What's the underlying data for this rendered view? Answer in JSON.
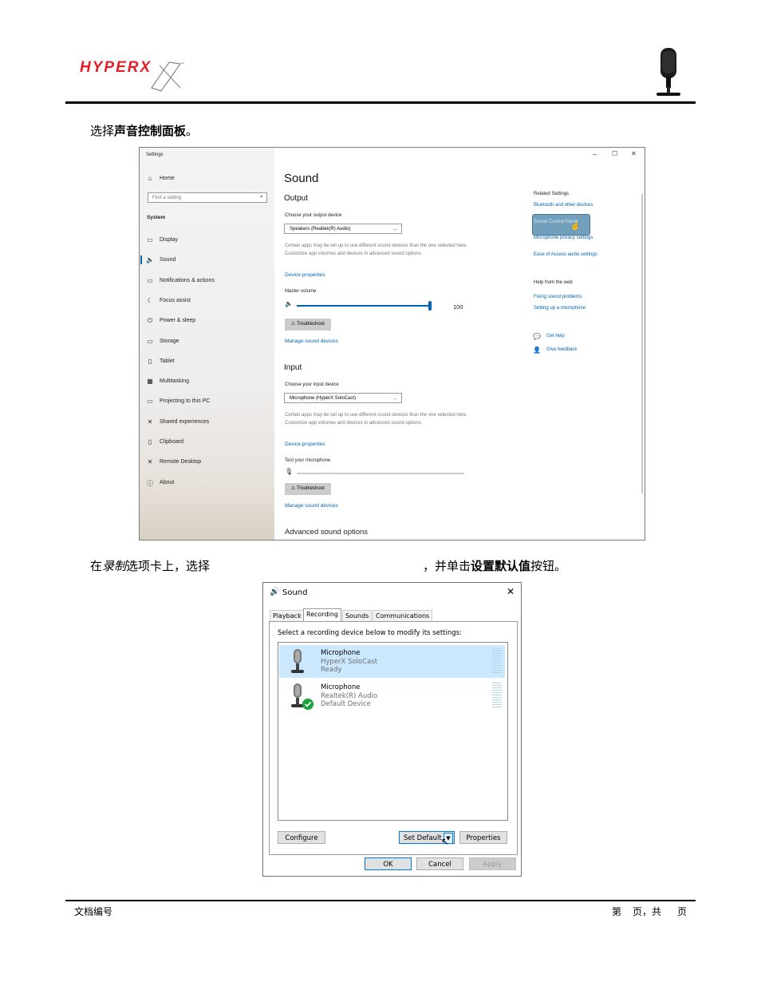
{
  "header": {
    "logo_text": "HYPERX",
    "logo_tm": "™"
  },
  "instructions": {
    "step1_prefix": "选择",
    "step1_bold": "声音控制面板",
    "step1_suffix": "。",
    "step2_prefix": "在",
    "step2_italic": "录制",
    "step2_mid": "选项卡上，选择",
    "step2_mid2": "，并单击",
    "step2_bold": "设置默认值",
    "step2_suffix": "按钮。"
  },
  "settings": {
    "window_title": "Settings",
    "controls": {
      "minimize": "–",
      "maximize": "☐",
      "close": "✕"
    },
    "home": "Home",
    "search_placeholder": "Find a setting",
    "section": "System",
    "nav": [
      {
        "label": "Display",
        "icon": "display-icon",
        "glyph": "▭"
      },
      {
        "label": "Sound",
        "icon": "speaker-icon",
        "glyph": "🔈"
      },
      {
        "label": "Notifications & actions",
        "icon": "notification-icon",
        "glyph": "▭"
      },
      {
        "label": "Focus assist",
        "icon": "moon-icon",
        "glyph": "☾"
      },
      {
        "label": "Power & sleep",
        "icon": "power-icon",
        "glyph": "⏻"
      },
      {
        "label": "Storage",
        "icon": "storage-icon",
        "glyph": "▭"
      },
      {
        "label": "Tablet",
        "icon": "tablet-icon",
        "glyph": "▯"
      },
      {
        "label": "Multitasking",
        "icon": "multitasking-icon",
        "glyph": "▦"
      },
      {
        "label": "Projecting to this PC",
        "icon": "projector-icon",
        "glyph": "▭"
      },
      {
        "label": "Shared experiences",
        "icon": "shared-icon",
        "glyph": "✕"
      },
      {
        "label": "Clipboard",
        "icon": "clipboard-icon",
        "glyph": "▯"
      },
      {
        "label": "Remote Desktop",
        "icon": "remote-icon",
        "glyph": "✕"
      },
      {
        "label": "About",
        "icon": "info-icon",
        "glyph": "ⓘ"
      }
    ],
    "page_title": "Sound",
    "output_heading": "Output",
    "output_choose": "Choose your output device",
    "output_device": "Speakers (Realtek(R) Audio)",
    "output_note": "Certain apps may be set up to use different sound devices than the one selected here. Customize app volumes and devices in advanced sound options.",
    "device_properties": "Device properties",
    "master_volume": "Master volume",
    "volume_value": "100",
    "volume_level": 1.0,
    "troubleshoot": "Troubleshoot",
    "manage_devices": "Manage sound devices",
    "input_heading": "Input",
    "input_choose": "Choose your input device",
    "input_device": "Microphone (HyperX SoloCast)",
    "input_note": "Certain apps may be set up to use different sound devices than the one selected here. Customize app volumes and devices in advanced sound options.",
    "input_device_properties": "Device properties",
    "test_mic": "Test your microphone",
    "input_troubleshoot": "Troubleshoot",
    "input_manage_devices": "Manage sound devices",
    "advanced": "Advanced sound options",
    "related_heading": "Related Settings",
    "related_links": [
      "Bluetooth and other devices",
      "Sound Control Panel",
      "Microphone privacy settings",
      "Ease of Access audio settings"
    ],
    "help_heading": "Help from the web",
    "help_links": [
      "Fixing sound problems",
      "Setting up a microphone"
    ],
    "get_help": "Get help",
    "give_feedback": "Give feedback"
  },
  "sound_dialog": {
    "title": "Sound",
    "tabs": [
      "Playback",
      "Recording",
      "Sounds",
      "Communications"
    ],
    "active_tab": "Recording",
    "instruction": "Select a recording device below to modify its settings:",
    "devices": [
      {
        "name": "Microphone",
        "line2": "HyperX SoloCast",
        "line3": "Ready",
        "selected": true
      },
      {
        "name": "Microphone",
        "line2": "Realtek(R) Audio",
        "line3": "Default Device",
        "selected": false
      }
    ],
    "configure": "Configure",
    "set_default": "Set Default",
    "properties": "Properties",
    "ok": "OK",
    "cancel": "Cancel",
    "apply": "Apply"
  },
  "footer": {
    "doc_number": "文档编号",
    "page_prefix": "第",
    "page_mid": "页，共",
    "page_suffix": "页"
  }
}
